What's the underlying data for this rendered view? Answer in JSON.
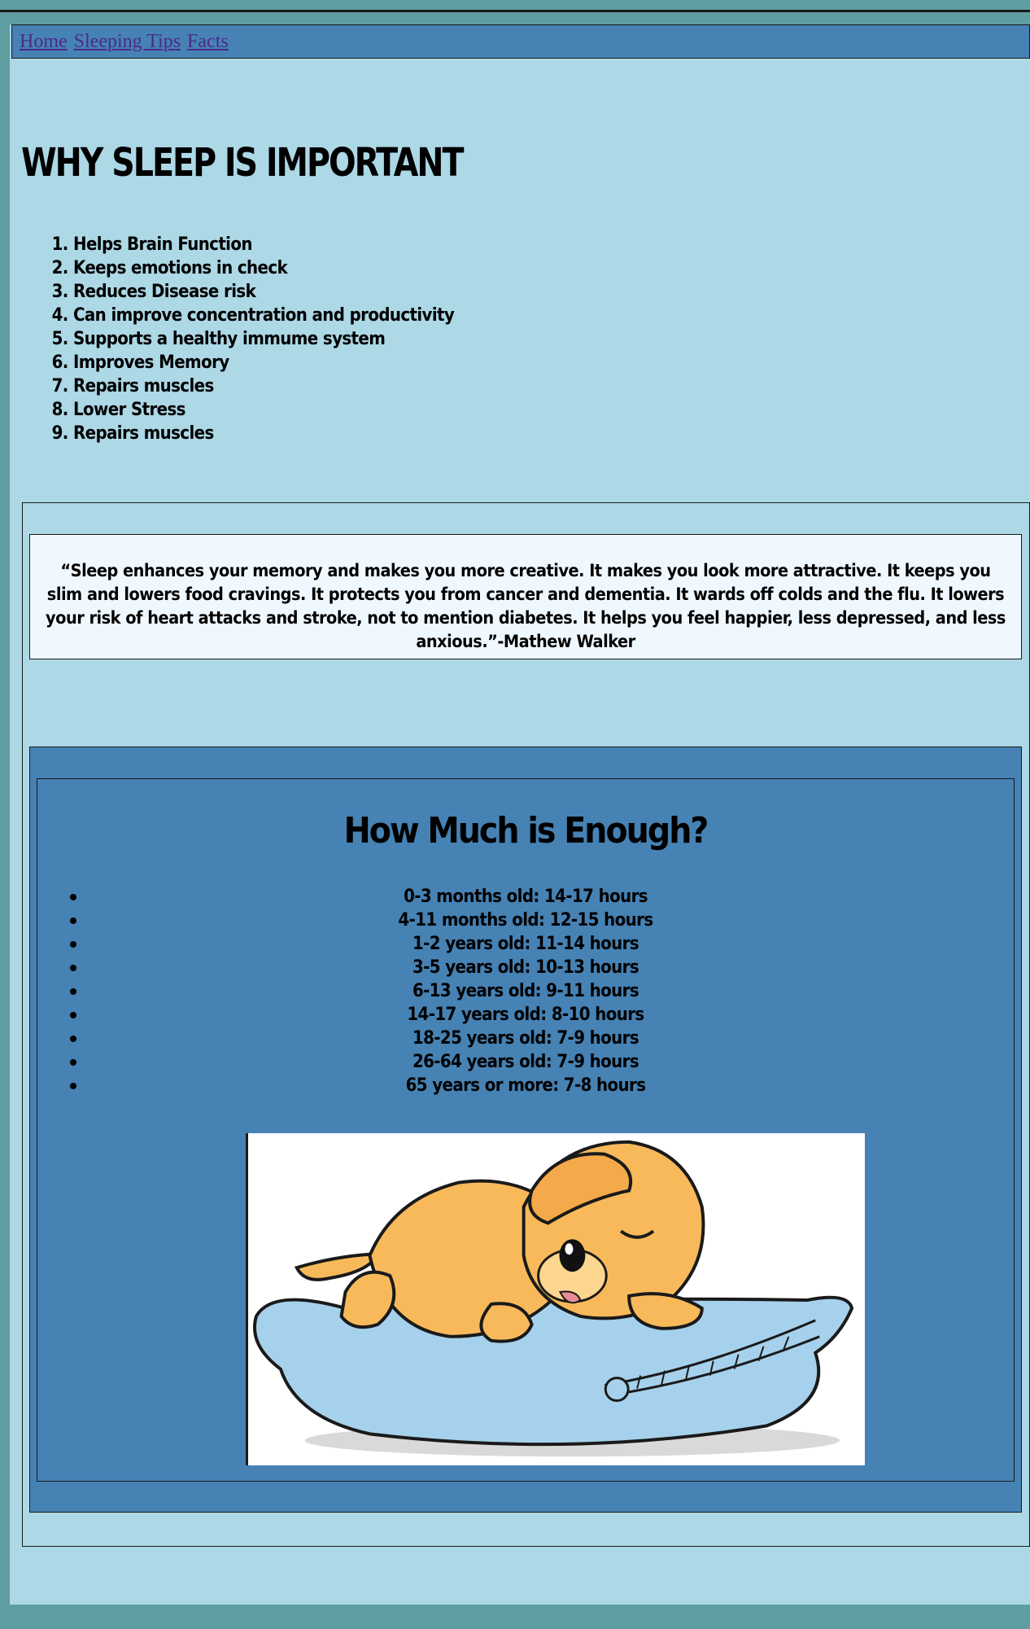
{
  "nav": {
    "links": [
      "Home",
      "Sleeping Tips",
      "Facts"
    ]
  },
  "main": {
    "title": "WHY SLEEP IS IMPORTANT",
    "reasons": [
      "Helps Brain Function",
      "Keeps emotions in check",
      "Reduces Disease risk",
      "Can improve concentration and productivity",
      "Supports a healthy immume system",
      "Improves Memory",
      "Repairs muscles",
      "Lower Stress",
      "Repairs muscles"
    ]
  },
  "quote": {
    "text": "“Sleep enhances your memory and makes you more creative. It makes you look more attractive. It keeps you slim and lowers food cravings. It protects you from cancer and dementia. It wards off colds and the flu. It lowers your risk of heart attacks and stroke, not to mention diabetes. It helps you feel happier, less depressed, and less anxious.”-Mathew Walker"
  },
  "enough": {
    "title": "How Much is Enough?",
    "items": [
      "0-3 months old: 14-17 hours",
      "4-11 months old: 12-15 hours",
      "1-2 years old: 11-14 hours",
      "3-5 years old: 10-13 hours",
      "6-13 years old: 9-11 hours",
      "14-17 years old: 8-10 hours",
      "18-25 years old: 7-9 hours",
      "26-64 years old: 7-9 hours",
      "65 years or more: 7-8 hours"
    ],
    "image_icon": "sleeping-puppy-on-pillow-illustration"
  },
  "colors": {
    "page_bg": "#5f9ea0",
    "content_bg": "#add8e6",
    "nav_bg": "#4682b4",
    "quote_bg": "#f0f8ff",
    "link": "#4b2a8a"
  }
}
